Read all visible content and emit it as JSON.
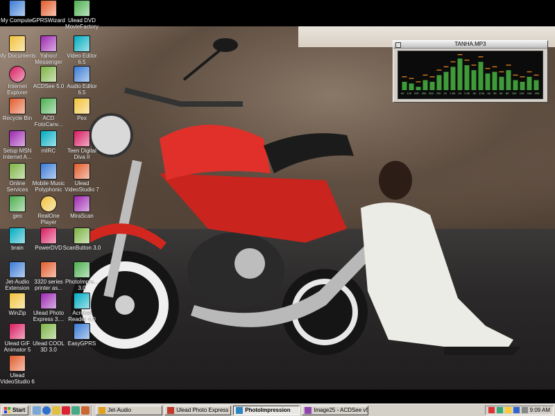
{
  "desktop": {
    "icons": [
      {
        "label": "My Computer",
        "icon": "my-computer-icon"
      },
      {
        "label": "GPRSWizard",
        "icon": "gprs-wizard-icon"
      },
      {
        "label": "Ulead DVD MovieFactory",
        "icon": "dvd-moviefactory-icon"
      },
      {
        "label": "My Documents",
        "icon": "my-documents-icon"
      },
      {
        "label": "Yahoo! Messenger",
        "icon": "yahoo-messenger-icon"
      },
      {
        "label": "Video Editor 6.5",
        "icon": "video-editor-icon"
      },
      {
        "label": "Internet Explorer",
        "icon": "internet-explorer-icon"
      },
      {
        "label": "ACDSee 5.0",
        "icon": "acdsee-icon"
      },
      {
        "label": "Audio Editor 6.5",
        "icon": "audio-editor-icon"
      },
      {
        "label": "Recycle Bin",
        "icon": "recycle-bin-icon"
      },
      {
        "label": "ACD FotoCanv...",
        "icon": "fotocanvas-icon"
      },
      {
        "label": "Pex",
        "icon": "pex-icon"
      },
      {
        "label": "Setup MSN Internet A...",
        "icon": "msn-icon"
      },
      {
        "label": "mIRC",
        "icon": "mirc-icon"
      },
      {
        "label": "Teen Digital Diva II",
        "icon": "teen-digital-diva-icon"
      },
      {
        "label": "Online Services",
        "icon": "folder-icon"
      },
      {
        "label": "Mobile Music Polyphonic",
        "icon": "mobile-music-icon"
      },
      {
        "label": "Ulead VideoStudio 7",
        "icon": "videostudio-icon"
      },
      {
        "label": "geo",
        "icon": "shortcut-icon"
      },
      {
        "label": "RealOne Player",
        "icon": "realone-player-icon"
      },
      {
        "label": "MiraScan",
        "icon": "mirascan-icon"
      },
      {
        "label": "brain",
        "icon": "shortcut-icon"
      },
      {
        "label": "PowerDVD",
        "icon": "powerdvd-icon"
      },
      {
        "label": "ScanButton 3.0",
        "icon": "scanbutton-icon"
      },
      {
        "label": "Jet-Audio Extension",
        "icon": "jetaudio-icon"
      },
      {
        "label": "3320 series printer as...",
        "icon": "hp-printer-icon"
      },
      {
        "label": "PhotoImpre... 3.0",
        "icon": "photoimpression-icon"
      },
      {
        "label": "WinZip",
        "icon": "winzip-icon"
      },
      {
        "label": "Ulead Photo Express 3....",
        "icon": "photo-express-icon"
      },
      {
        "label": "Acrobat Reader 4.0",
        "icon": "acrobat-reader-icon"
      },
      {
        "label": "Ulead GIF Animator 5",
        "icon": "gif-animator-icon"
      },
      {
        "label": "Ulead COOL 3D 3.0",
        "icon": "cool3d-icon"
      },
      {
        "label": "EasyGPRS",
        "icon": "easygprs-icon"
      },
      {
        "label": "Ulead VideoStudio 6",
        "icon": "videostudio-icon"
      }
    ]
  },
  "player": {
    "title": "TANHA.MP3",
    "bands": [
      "60",
      "120",
      "200",
      "300",
      "500",
      "700",
      "1K",
      "1.5K",
      "2K",
      "2.5K",
      "3K",
      "3.5K",
      "4K",
      "5K",
      "6K",
      "8K",
      "10K",
      "12K",
      "16K",
      "20K"
    ],
    "levels": [
      0.25,
      0.2,
      0.1,
      0.3,
      0.25,
      0.45,
      0.55,
      0.7,
      0.95,
      0.75,
      0.6,
      0.85,
      0.5,
      0.55,
      0.4,
      0.6,
      0.3,
      0.25,
      0.4,
      0.3
    ]
  },
  "taskbar": {
    "start_label": "Start",
    "tasks": [
      {
        "label": "Jet-Audio",
        "active": false
      },
      {
        "label": "Ulead Photo Express -...",
        "active": false
      },
      {
        "label": "PhotoImpression",
        "active": true
      },
      {
        "label": "Image25 - ACDSee v5.0",
        "active": false
      }
    ],
    "clock": "9:09 AM"
  },
  "colors": {
    "taskbar": "#d4d0c8",
    "bike_red": "#d2271f",
    "eq_green": "#3f9a3a",
    "eq_peak": "#c8761e"
  }
}
